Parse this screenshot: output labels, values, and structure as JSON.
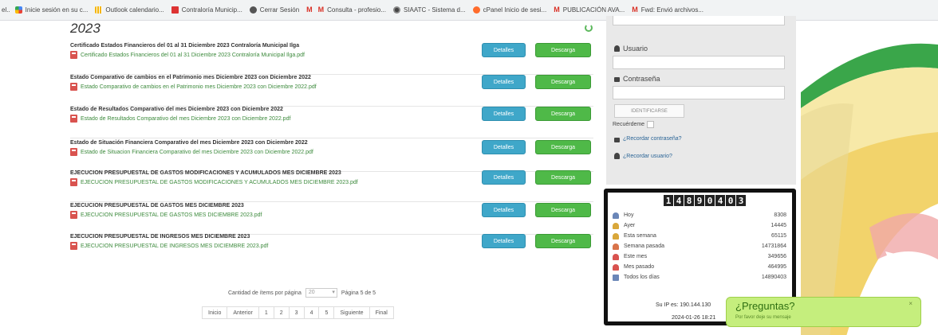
{
  "bookmarks": [
    {
      "icon": "apps-icon",
      "label": "Inicie sesión en su c..."
    },
    {
      "icon": "grid-icon",
      "label": "Outlook calendario..."
    },
    {
      "icon": "red-icon",
      "label": "Contraloría Municip..."
    },
    {
      "icon": "ms-icon",
      "label": "Cerrar Sesión"
    },
    {
      "icon": "gmail-icon",
      "label": ""
    },
    {
      "icon": "gmail-icon",
      "label": "Consulta - profesio..."
    },
    {
      "icon": "globe-icon",
      "label": "SIAATC - Sistema d..."
    },
    {
      "icon": "cp-icon",
      "label": "cPanel Inicio de sesi..."
    },
    {
      "icon": "gmail-icon",
      "label": "PUBLICACIÓN AVA..."
    },
    {
      "icon": "gmail-icon",
      "label": "Fwd: Envió archivos..."
    }
  ],
  "main": {
    "year": "2023",
    "rows": [
      {
        "title": "Certificado Estados Financieros del 01 al 31 Diciembre 2023 Contraloría Municipal Ilga",
        "file": "Certificado Estados Financieros del 01 al 31 Diciembre 2023 Contraloría Municipal Ilga.pdf",
        "details": "Detalles",
        "download": "Descarga"
      },
      {
        "title": "Estado Comparativo de cambios en el Patrimonio mes Diciembre 2023 con Diciembre 2022",
        "file": "Estado Comparativo de cambios en el Patrimonio mes Diciembre 2023 con Diciembre 2022.pdf",
        "details": "Detalles",
        "download": "Descarga"
      },
      {
        "title": "Estado de Resultados Comparativo del mes Diciembre 2023 con Diciembre 2022",
        "file": "Estado de Resultados Comparativo del mes Diciembre 2023 con Diciembre 2022.pdf",
        "details": "Detalles",
        "download": "Descarga"
      },
      {
        "title": "Estado de Situación Financiera Comparativo del mes Diciembre 2023 con Diciembre 2022",
        "file": "Estado de Situacion Financiera Comparativo del mes Diciembre 2023 con Diciembre 2022.pdf",
        "details": "Detalles",
        "download": "Descarga"
      },
      {
        "title": "EJECUCION PRESUPUESTAL DE GASTOS MODIFICACIONES Y ACUMULADOS MES DICIEMBRE 2023",
        "file": "EJECUCION PRESUPUESTAL DE GASTOS MODIFICACIONES Y ACUMULADOS MES DICIEMBRE 2023.pdf",
        "details": "Detalles",
        "download": "Descarga"
      },
      {
        "title": "EJECUCION PRESUPUESTAL DE GASTOS MES DICIEMBRE 2023",
        "file": "EJECUCION PRESUPUESTAL DE GASTOS MES DICIEMBRE 2023.pdf",
        "details": "Detalles",
        "download": "Descarga"
      },
      {
        "title": "EJECUCION PRESUPUESTAL DE INGRESOS MES DICIEMBRE 2023",
        "file": "EJECUCION PRESUPUESTAL DE INGRESOS MES DICIEMBRE 2023.pdf",
        "details": "Detalles",
        "download": "Descarga"
      }
    ],
    "pagination": {
      "per_page_label": "Cantidad de ítems por página",
      "per_page_value": "20",
      "page_info": "Página 5 de 5",
      "buttons": [
        "Inicio",
        "Anterior",
        "1",
        "2",
        "3",
        "4",
        "5",
        "Siguiente",
        "Final"
      ]
    }
  },
  "login": {
    "user_label": "Usuario",
    "password_label": "Contraseña",
    "submit": "IDENTIFICARSE",
    "remember": "Recuérdeme",
    "forgot_password": "¿Recordar contraseña?",
    "forgot_user": "¿Recordar usuario?"
  },
  "counter": {
    "total_digits": "14890403",
    "stats": [
      {
        "label": "Hoy",
        "value": "8308",
        "color": "#6a86b8"
      },
      {
        "label": "Ayer",
        "value": "14445",
        "color": "#d9a73a"
      },
      {
        "label": "Esta semana",
        "value": "65115",
        "color": "#d9a73a"
      },
      {
        "label": "Semana pasada",
        "value": "14731864",
        "color": "#d9734a"
      },
      {
        "label": "Este mes",
        "value": "349656",
        "color": "#d9534f"
      },
      {
        "label": "Mes pasado",
        "value": "464995",
        "color": "#d9534f"
      },
      {
        "label": "Todos los días",
        "value": "14890403",
        "color": "#6a86b8"
      }
    ],
    "ip_text": "Su IP es: 190.144.130",
    "date_text": "2024-01-26 18:21"
  },
  "chat": {
    "title": "¿Preguntas?",
    "subtitle": "Por favor deje su mensaje",
    "close": "×"
  },
  "colors": {
    "details_button": "#3fa7c9",
    "download_button": "#4fb948",
    "chat_bg": "#c5ee7d"
  }
}
